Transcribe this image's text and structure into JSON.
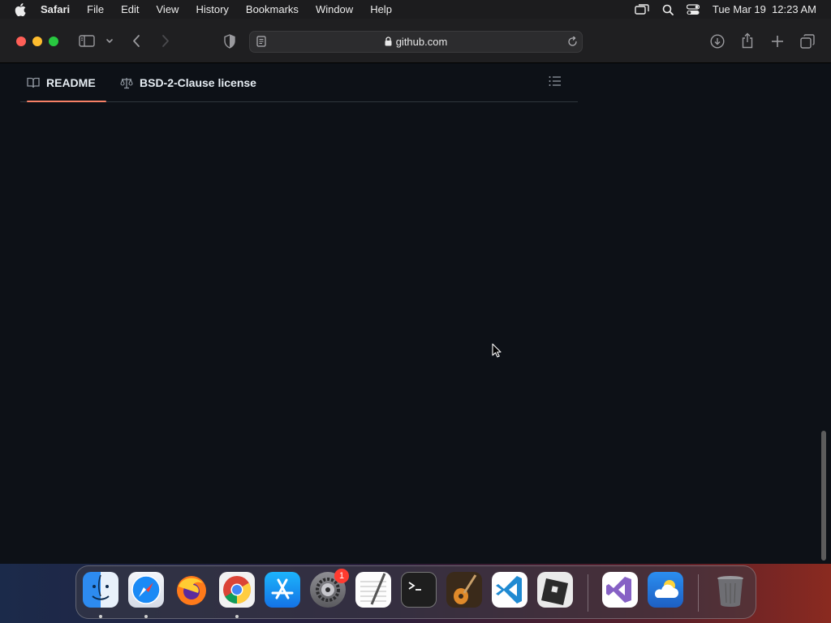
{
  "menubar": {
    "app_name": "Safari",
    "items": [
      "File",
      "Edit",
      "View",
      "History",
      "Bookmarks",
      "Window",
      "Help"
    ],
    "clock": "Tue Mar 19  12:23 AM",
    "icons": [
      "screen-mirroring-icon",
      "spotlight-search-icon",
      "control-center-icon"
    ]
  },
  "browser": {
    "url": "github.com",
    "toolbar_icons": [
      "sidebar-icon",
      "chevron-down-icon",
      "back-icon",
      "forward-icon",
      "privacy-shield-icon",
      "reader-icon",
      "reload-icon",
      "download-icon",
      "share-icon",
      "new-tab-icon",
      "tab-overview-icon"
    ]
  },
  "page": {
    "tabs": [
      {
        "label": "README",
        "icon": "book-icon",
        "active": true
      },
      {
        "label": "BSD-2-Clause license",
        "icon": "scale-icon",
        "active": false
      }
    ],
    "outline_icon": "list-outline-icon"
  },
  "dock": {
    "apps": [
      {
        "name": "Finder",
        "running": true
      },
      {
        "name": "Safari",
        "running": true
      },
      {
        "name": "Firefox",
        "running": false
      },
      {
        "name": "Chrome",
        "running": true
      },
      {
        "name": "App Store",
        "running": false
      },
      {
        "name": "System Settings",
        "running": false,
        "badge": "1"
      },
      {
        "name": "TextEdit",
        "running": false
      },
      {
        "name": "Terminal",
        "running": false
      },
      {
        "name": "GarageBand",
        "running": false
      },
      {
        "name": "Visual Studio Code",
        "running": false
      },
      {
        "name": "Roblox",
        "running": false
      },
      {
        "name": "Visual Studio",
        "running": false
      },
      {
        "name": "Weather",
        "running": false
      },
      {
        "name": "Trash",
        "running": false
      }
    ]
  },
  "colors": {
    "page_bg": "#0d1117",
    "tab_underline": "#f78166",
    "text": "#e6edf3"
  }
}
